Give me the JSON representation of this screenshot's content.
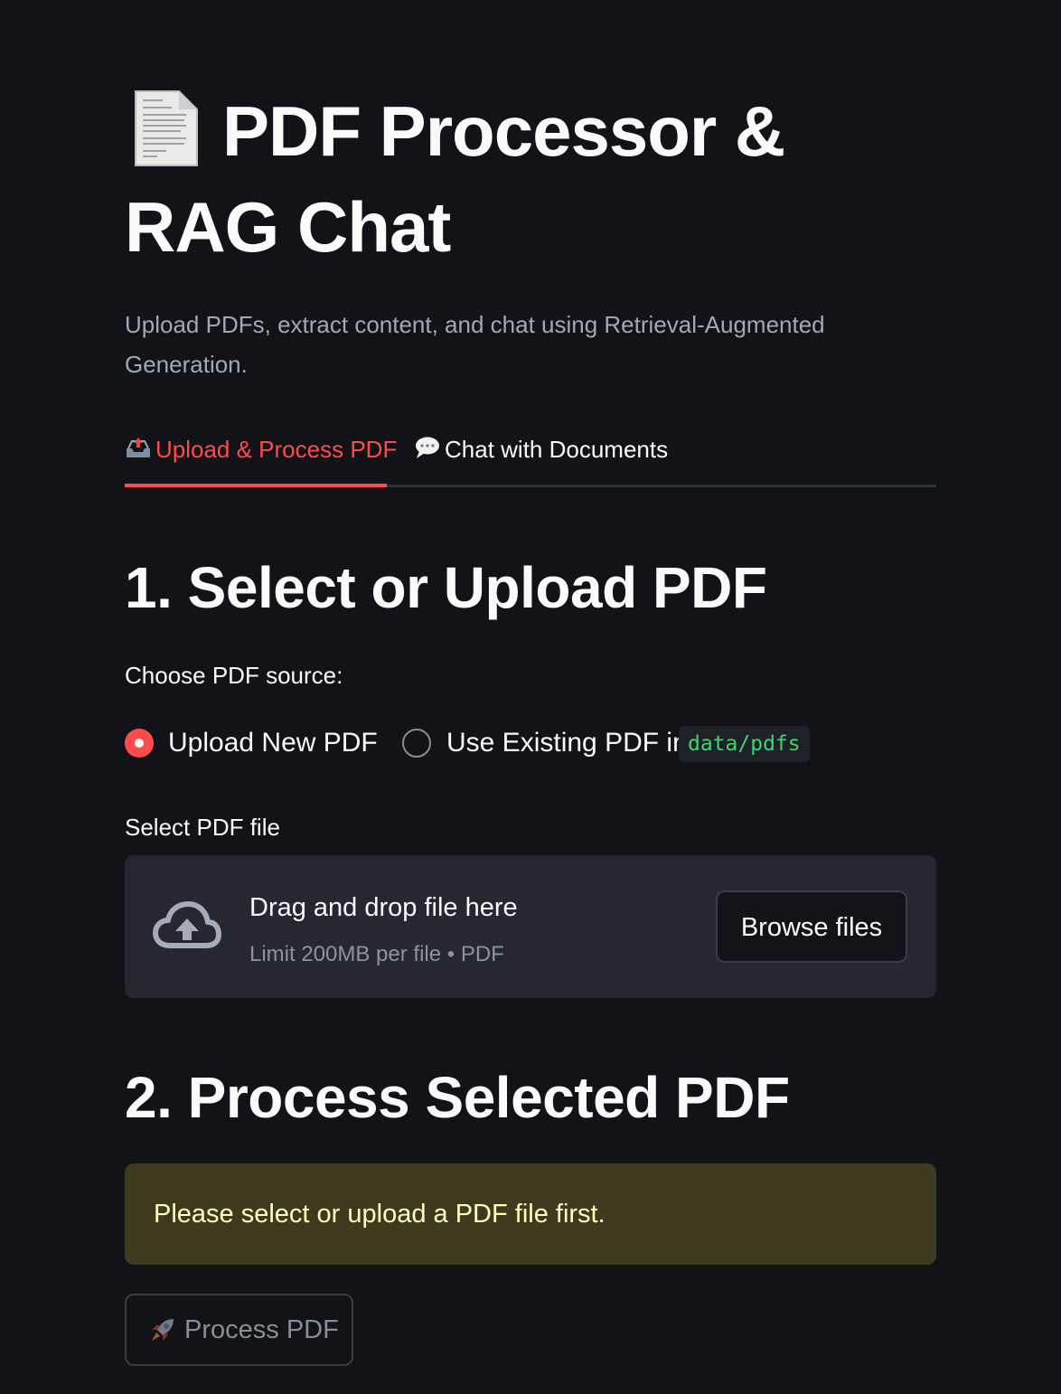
{
  "header": {
    "title_line1": "PDF Processor &",
    "title_line2": "RAG Chat",
    "subtitle": "Upload PDFs, extract content, and chat using Retrieval-Augmented Generation.",
    "icon": "page-facing-up-icon"
  },
  "tabs": [
    {
      "label": "Upload & Process PDF",
      "icon": "outbox-tray-icon",
      "active": true
    },
    {
      "label": "Chat with Documents",
      "icon": "speech-bubble-icon",
      "active": false
    }
  ],
  "section1": {
    "heading": "1. Select or Upload PDF",
    "radio_label": "Choose PDF source:",
    "options": [
      {
        "label": "Upload New PDF",
        "selected": true
      },
      {
        "label": "Use Existing PDF in",
        "code": "data/pdfs",
        "selected": false
      }
    ],
    "file_label": "Select PDF file",
    "uploader": {
      "title": "Drag and drop file here",
      "hint": "Limit 200MB per file • PDF",
      "button": "Browse files",
      "icon": "cloud-upload-icon"
    }
  },
  "section2": {
    "heading": "2. Process Selected PDF",
    "warning": "Please select or upload a PDF file first.",
    "button": "Process PDF",
    "button_icon": "rocket-icon",
    "button_disabled": true
  },
  "colors": {
    "background": "#121318",
    "accent": "#ff4b4b",
    "warning_bg": "#3e3a1d",
    "warning_text": "#ffffc2",
    "code_text": "#3dd56d"
  }
}
